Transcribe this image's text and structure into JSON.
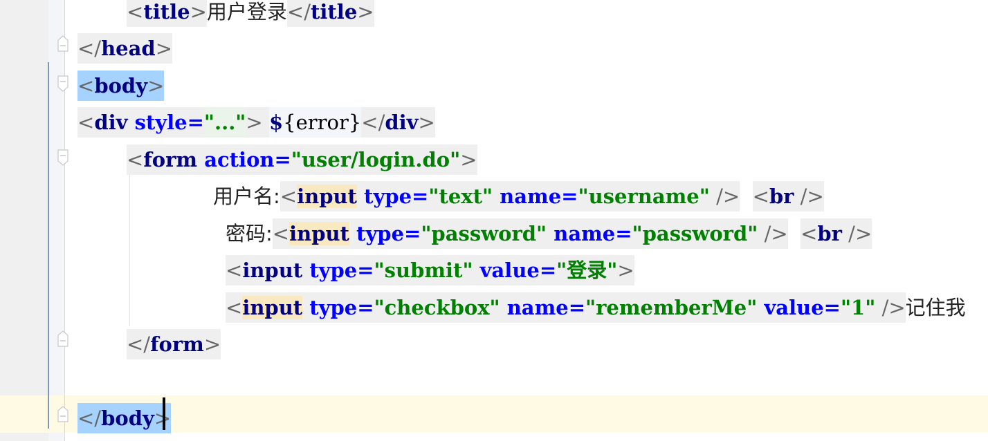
{
  "editor": {
    "language": "html",
    "lines": [
      {
        "id": "title",
        "indent": "    ",
        "open": "<",
        "tag": "title",
        "close": ">",
        "text": "用户登录",
        "end_open": "</",
        "end_tag": "title",
        "end_close": ">"
      },
      {
        "id": "head-close",
        "open": "</",
        "tag": "head",
        "close": ">"
      },
      {
        "id": "body-open",
        "open": "<",
        "tag": "body",
        "close": ">"
      },
      {
        "id": "div",
        "open": "<",
        "tag": "div",
        "attr": " style=",
        "val": "\"...\"",
        "close": ">",
        "el_dollar": "$",
        "el_body": "{error}",
        "end_open": "</",
        "end_tag": "div",
        "end_close": ">"
      },
      {
        "id": "form-open",
        "open": "<",
        "tag": "form",
        "attr": " action=",
        "val": "\"user/login.do\"",
        "close": ">"
      },
      {
        "id": "username",
        "label": "用户名:",
        "open": "<",
        "tag": "input",
        "attr1": " type=",
        "val1": "\"text\"",
        "attr2": " name=",
        "val2": "\"username\"",
        "close": " />",
        "br_open": "<",
        "br_tag": "br",
        "br_close": " />"
      },
      {
        "id": "password",
        "label": "密码:",
        "open": "<",
        "tag": "input",
        "attr1": " type=",
        "val1": "\"password\"",
        "attr2": " name=",
        "val2": "\"password\"",
        "close": " />",
        "br_open": "<",
        "br_tag": "br",
        "br_close": " />"
      },
      {
        "id": "submit",
        "open": "<",
        "tag": "input",
        "attr1": " type=",
        "val1": "\"submit\"",
        "attr2": " value=",
        "val2": "\"登录\"",
        "close": ">"
      },
      {
        "id": "checkbox",
        "open": "<",
        "tag": "input",
        "attr1": " type=",
        "val1": "\"checkbox\"",
        "attr2": " name=",
        "val2": "\"rememberMe\"",
        "attr3": " value=",
        "val3": "\"1\"",
        "close": " />",
        "text": "记住我"
      },
      {
        "id": "form-close",
        "open": "</",
        "tag": "form",
        "close": ">"
      },
      {
        "id": "body-close",
        "open": "</",
        "tag": "body",
        "close": ">"
      }
    ]
  },
  "colors": {
    "tag": "#000080",
    "attribute": "#0000ff",
    "value": "#008000",
    "selection": "#a6d2ff",
    "current_line": "#fffae3",
    "tag_match": "#f8e9c0"
  }
}
